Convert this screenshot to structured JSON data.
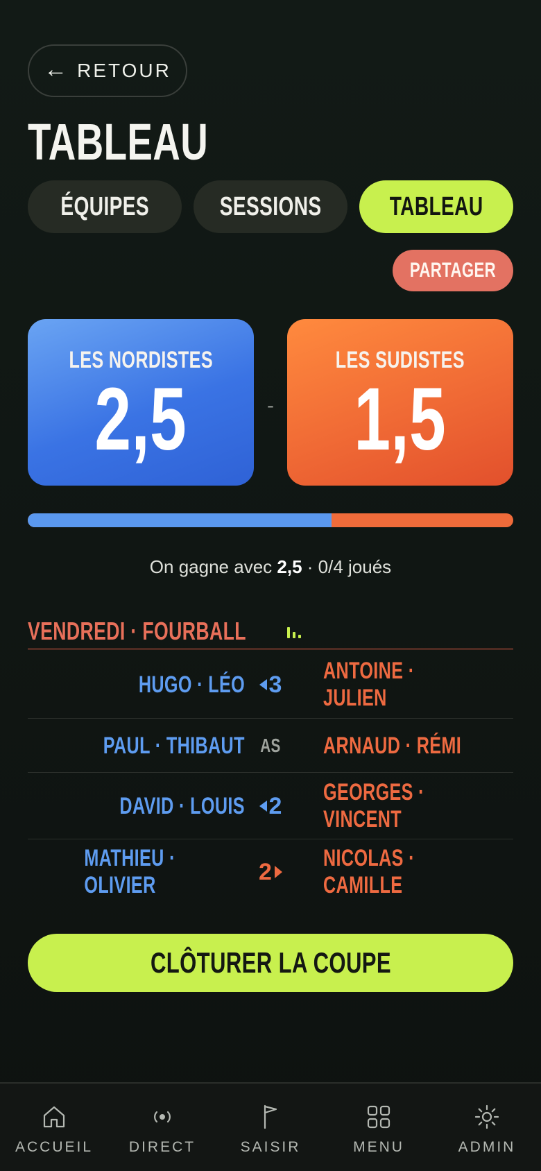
{
  "header": {
    "back_label": "RETOUR",
    "back_arrow": "←",
    "title": "TABLEAU"
  },
  "tabs": [
    {
      "label": "ÉQUIPES",
      "active": false
    },
    {
      "label": "SESSIONS",
      "active": false
    },
    {
      "label": "TABLEAU",
      "active": true
    }
  ],
  "share_label": "PARTAGER",
  "scoreboard": {
    "team_a": {
      "name": "LES NORDISTES",
      "score": "2,5",
      "color": "#4a86ea"
    },
    "separator": "-",
    "team_b": {
      "name": "LES SUDISTES",
      "score": "1,5",
      "color": "#f06a35"
    },
    "progress_fraction_a": 0.625
  },
  "status": {
    "prefix": "On gagne avec",
    "value": "2,5",
    "suffix": "· 0/4 joués"
  },
  "section": {
    "title": "VENDREDI · FOURBALL",
    "icon": "bars-icon"
  },
  "matches": [
    {
      "left": "HUGO · LÉO",
      "mid": "3",
      "leader": "left",
      "right": "ANTOINE · JULIEN"
    },
    {
      "left": "PAUL · THIBAUT",
      "mid": "AS",
      "leader": "none",
      "right": "ARNAUD · RÉMI"
    },
    {
      "left": "DAVID · LOUIS",
      "mid": "2",
      "leader": "left",
      "right": "GEORGES · VINCENT"
    },
    {
      "left": "MATHIEU · OLIVIER",
      "mid": "2",
      "leader": "right",
      "right": "NICOLAS · CAMILLE"
    }
  ],
  "close_label": "CLÔTURER LA COUPE",
  "nav": [
    {
      "label": "ACCUEIL",
      "icon": "home-icon"
    },
    {
      "label": "DIRECT",
      "icon": "live-icon"
    },
    {
      "label": "SAISIR",
      "icon": "flag-icon"
    },
    {
      "label": "MENU",
      "icon": "grid-icon"
    },
    {
      "label": "ADMIN",
      "icon": "sun-gear-icon"
    }
  ],
  "colors": {
    "accent": "#c8f04e",
    "blue": "#5e9cf0",
    "orange": "#ee6a41",
    "share": "#e37262"
  }
}
